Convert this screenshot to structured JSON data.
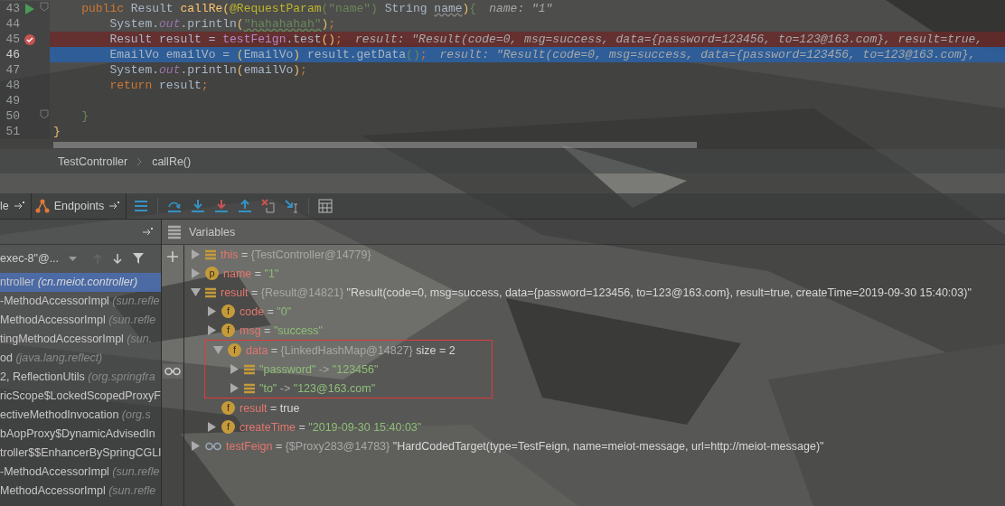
{
  "editor": {
    "lines": [
      {
        "number": "43",
        "run_marker": true,
        "fold": true,
        "breakpoint": false,
        "current": false,
        "tokens": [
          {
            "kind": "kw",
            "text": "    public"
          },
          {
            "kind": "plain",
            "text": " Result "
          },
          {
            "kind": "fn",
            "text": "callRe"
          },
          {
            "kind": "paren",
            "text": "("
          },
          {
            "kind": "ann",
            "text": "@RequestParam"
          },
          {
            "kind": "str",
            "text": "(\"name\")"
          },
          {
            "kind": "plain",
            "text": " String "
          },
          {
            "kind": "warn",
            "text": "name"
          },
          {
            "kind": "paren",
            "text": ")"
          },
          {
            "kind": "str",
            "text": "{"
          }
        ],
        "hint": "name: \"1\""
      },
      {
        "number": "44",
        "run_marker": false,
        "fold": false,
        "breakpoint": false,
        "current": false,
        "tokens": [
          {
            "kind": "plain",
            "text": "        System."
          },
          {
            "kind": "field",
            "text": "out"
          },
          {
            "kind": "plain",
            "text": ".println"
          },
          {
            "kind": "paren",
            "text": "("
          },
          {
            "kind": "typo",
            "text": "\"hahahahah\""
          },
          {
            "kind": "paren",
            "text": ")"
          },
          {
            "kind": "kw",
            "text": ";"
          }
        ]
      },
      {
        "number": "45",
        "run_marker": false,
        "fold": false,
        "breakpoint": true,
        "current": false,
        "tokens": [
          {
            "kind": "plain",
            "text": "        Result result = "
          },
          {
            "kind": "member",
            "text": "testFeign"
          },
          {
            "kind": "plain",
            "text": ".test"
          },
          {
            "kind": "paren",
            "text": "()"
          },
          {
            "kind": "kw",
            "text": ";"
          }
        ],
        "hint": "result: \"Result(code=0, msg=success, data={password=123456, to=123@163.com}, result=true,"
      },
      {
        "number": "46",
        "run_marker": false,
        "fold": false,
        "breakpoint": false,
        "current": true,
        "tokens": [
          {
            "kind": "plain",
            "text": "        EmailVo emailVo = "
          },
          {
            "kind": "paren",
            "text": "("
          },
          {
            "kind": "plain",
            "text": "EmailVo"
          },
          {
            "kind": "paren",
            "text": ")"
          },
          {
            "kind": "plain",
            "text": " result.getData"
          },
          {
            "kind": "str",
            "text": "()"
          },
          {
            "kind": "kw",
            "text": ";"
          }
        ],
        "hint": "result: \"Result(code=0, msg=success, data={password=123456, to=123@163.com},"
      },
      {
        "number": "47",
        "run_marker": false,
        "fold": false,
        "breakpoint": false,
        "current": false,
        "tokens": [
          {
            "kind": "plain",
            "text": "        System."
          },
          {
            "kind": "field",
            "text": "out"
          },
          {
            "kind": "plain",
            "text": ".println"
          },
          {
            "kind": "paren",
            "text": "("
          },
          {
            "kind": "plain",
            "text": "emailVo"
          },
          {
            "kind": "paren",
            "text": ")"
          },
          {
            "kind": "kw",
            "text": ";"
          }
        ]
      },
      {
        "number": "48",
        "run_marker": false,
        "fold": false,
        "breakpoint": false,
        "current": false,
        "tokens": [
          {
            "kind": "kw",
            "text": "        return"
          },
          {
            "kind": "plain",
            "text": " result"
          },
          {
            "kind": "kw",
            "text": ";"
          }
        ]
      },
      {
        "number": "49",
        "run_marker": false,
        "fold": false,
        "breakpoint": false,
        "current": false
      },
      {
        "number": "50",
        "run_marker": false,
        "fold": true,
        "breakpoint": false,
        "current": false,
        "tokens": [
          {
            "kind": "str",
            "text": "    }"
          }
        ]
      },
      {
        "number": "51",
        "run_marker": false,
        "fold": false,
        "breakpoint": false,
        "current": false,
        "tokens": [
          {
            "kind": "paren",
            "text": "}"
          }
        ]
      }
    ]
  },
  "breadcrumb": [
    "TestController",
    "callRe()"
  ],
  "toolbar": {
    "tabs": [
      {
        "kind": "plain",
        "label": "le"
      },
      {
        "kind": "endpoints",
        "label": "Endpoints"
      }
    ]
  },
  "frames": {
    "thread": "exec-8\"@...",
    "items": [
      {
        "method": "ntroller",
        "location": "(cn.meiot.controller)",
        "selected": true
      },
      {
        "method": "-MethodAccessorImpl",
        "location": "(sun.refle",
        "selected": false
      },
      {
        "method": "MethodAccessorImpl",
        "location": "(sun.refle",
        "selected": false
      },
      {
        "method": "tingMethodAccessorImpl",
        "location": "(sun.",
        "selected": false
      },
      {
        "method": "od",
        "location": "(java.lang.reflect)",
        "selected": false
      },
      {
        "method": "2, ReflectionUtils",
        "location": "(org.springfra",
        "selected": false
      },
      {
        "method": "ricScope$LockedScopedProxyF",
        "selected": false
      },
      {
        "method": "ectiveMethodInvocation",
        "location": "(org.s",
        "selected": false
      },
      {
        "method": "bAopProxy$DynamicAdvisedIn",
        "selected": false
      },
      {
        "method": "troller$$EnhancerBySpringCGLI",
        "selected": false
      },
      {
        "method": "-MethodAccessorImpl",
        "location": "(sun.refle",
        "selected": false
      },
      {
        "method": "MethodAccessorImpl",
        "location": "(sun.refle",
        "selected": false
      }
    ]
  },
  "variables": {
    "title": "Variables",
    "items": [
      {
        "kind": "object",
        "name": "this",
        "eq": "=",
        "ref": "{TestController@14779}",
        "expanded": false
      },
      {
        "kind": "param",
        "badge": "p",
        "name": "name",
        "eq": "=",
        "value": "\"1\"",
        "expanded": false
      },
      {
        "kind": "object",
        "name": "result",
        "eq": "=",
        "ref": "{Result@14821}",
        "text": "\"Result(code=0, msg=success, data={password=123456, to=123@163.com}, result=true, createTime=2019-09-30 15:40:03)\"",
        "expanded": true,
        "children": [
          {
            "kind": "field",
            "badge": "f",
            "name": "code",
            "eq": "=",
            "value": "\"0\"",
            "expanded": false
          },
          {
            "kind": "field",
            "badge": "f",
            "name": "msg",
            "eq": "=",
            "value": "\"success\"",
            "expanded": false
          },
          {
            "kind": "field",
            "badge": "f",
            "name": "data",
            "eq": "=",
            "ref": "{LinkedHashMap@14827}",
            "text": "size = 2",
            "expanded": true,
            "highlighted": true,
            "children": [
              {
                "kind": "entry",
                "key": "\"password\"",
                "arrow": "->",
                "value": "\"123456\"",
                "expanded": false
              },
              {
                "kind": "entry",
                "key": "\"to\"",
                "arrow": "->",
                "value": "\"123@163.com\"",
                "expanded": false
              }
            ]
          },
          {
            "kind": "field",
            "badge": "f",
            "name": "result",
            "eq": "=",
            "text": "true",
            "leaf": true
          },
          {
            "kind": "field",
            "badge": "f",
            "name": "createTime",
            "eq": "=",
            "value": "\"2019-09-30 15:40:03\"",
            "expanded": false
          }
        ]
      },
      {
        "kind": "watch",
        "name": "testFeign",
        "eq": "=",
        "ref": "{$Proxy283@14783}",
        "text": "\"HardCodedTarget(type=TestFeign, name=meiot-message, url=http://meiot-message)\"",
        "expanded": false
      }
    ]
  }
}
